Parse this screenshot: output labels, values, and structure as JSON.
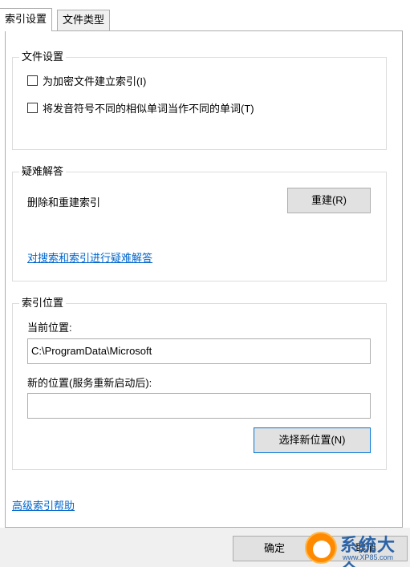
{
  "tabs": [
    {
      "label": "索引设置",
      "active": true
    },
    {
      "label": "文件类型",
      "active": false
    }
  ],
  "file_settings": {
    "title": "文件设置",
    "options": [
      {
        "label": "为加密文件建立索引(I)",
        "checked": false
      },
      {
        "label": "将发音符号不同的相似单词当作不同的单词(T)",
        "checked": false
      }
    ]
  },
  "troubleshooting": {
    "title": "疑难解答",
    "rebuild_text": "删除和重建索引",
    "rebuild_button": "重建(R)",
    "help_link": "对搜索和索引进行疑难解答"
  },
  "index_location": {
    "title": "索引位置",
    "current_label": "当前位置:",
    "current_value": "C:\\ProgramData\\Microsoft",
    "new_label": "新的位置(服务重新启动后):",
    "new_value": "",
    "select_button": "选择新位置(N)"
  },
  "advanced_help_link": "高级索引帮助",
  "footer": {
    "ok_button": "确定",
    "cancel_button": "取消"
  },
  "watermark": {
    "text": "系统大全",
    "url": "www.XP85.com"
  },
  "colors": {
    "link": "#0066cc",
    "button_bg": "#e1e1e1",
    "focus_border": "#0078d7",
    "watermark_orange": "#ff8a00",
    "watermark_blue": "#2a63a8"
  }
}
